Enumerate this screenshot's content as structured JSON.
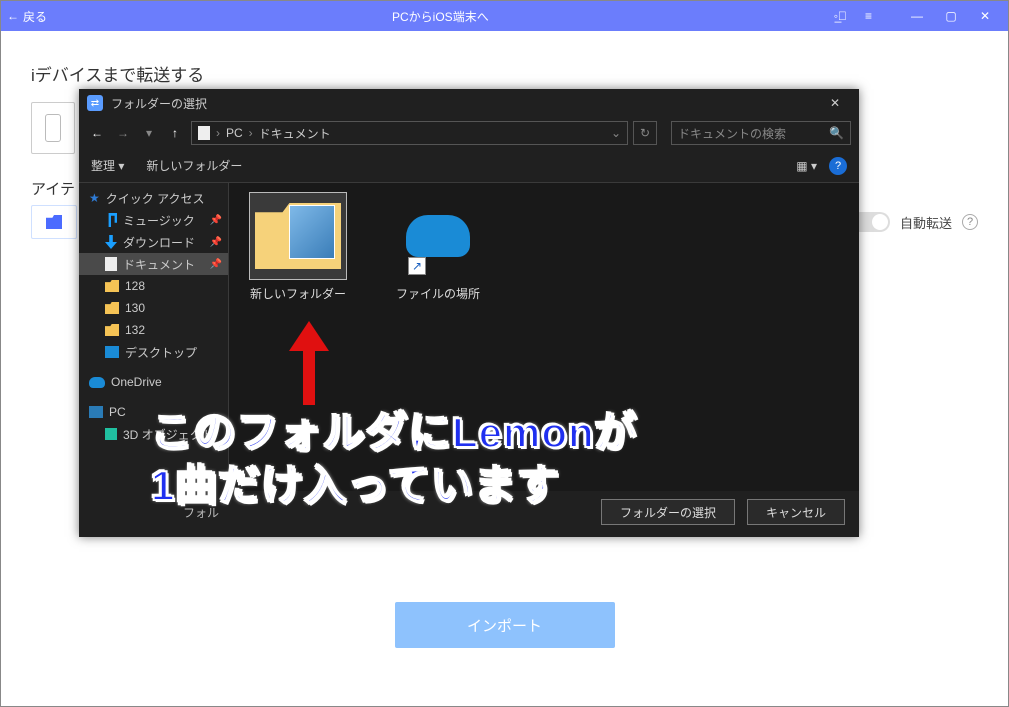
{
  "header": {
    "back_label": "戻る",
    "title": "PCからiOS端末へ"
  },
  "app": {
    "section1": "iデバイスまで転送する",
    "item_label_prefix": "アイテ",
    "auto_transfer": "自動転送",
    "import": "インポート"
  },
  "dialog": {
    "title": "フォルダーの選択",
    "breadcrumb": {
      "root": "PC",
      "current": "ドキュメント"
    },
    "search_placeholder": "ドキュメントの検索",
    "organize": "整理",
    "new_folder_btn": "新しいフォルダー",
    "tree": {
      "quick": "クイック アクセス",
      "music": "ミュージック",
      "download": "ダウンロード",
      "documents": "ドキュメント",
      "f128": "128",
      "f130": "130",
      "f132": "132",
      "desktop": "デスクトップ",
      "onedrive": "OneDrive",
      "pc": "PC",
      "objects3d": "3D オブジェクト"
    },
    "tiles": {
      "new_folder": "新しいフォルダー",
      "file_location": "ファイルの場所"
    },
    "folder_field_label": "フォル",
    "select_btn": "フォルダーの選択",
    "cancel_btn": "キャンセル"
  },
  "annotation": {
    "line1": "このフォルダにLemonが",
    "line2": "1曲だけ入っています"
  }
}
